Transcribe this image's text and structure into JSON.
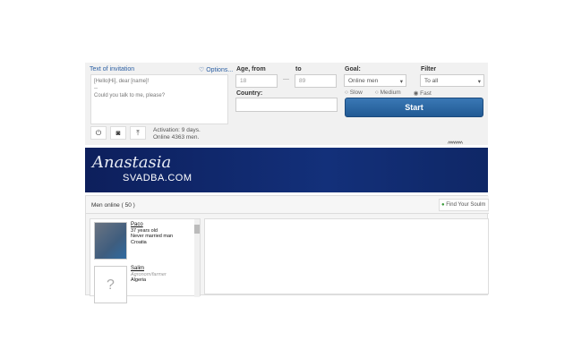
{
  "invitation": {
    "title": "Text of invitation",
    "options": "♡ Options...",
    "line1": "[Hello|Hi], dear [name]!",
    "line2": "--",
    "line3": "Could you talk to me, please?",
    "activation": "Activation: 9 days.",
    "online": "Online 4363 men."
  },
  "age": {
    "label_from": "Age, from",
    "from": "18",
    "dash": "—",
    "label_to": "to",
    "to": "89"
  },
  "country": {
    "label": "Country:",
    "value": ""
  },
  "goal": {
    "label": "Goal:",
    "value": "Online men"
  },
  "filter": {
    "label": "Filter",
    "value": "To all"
  },
  "speed": {
    "options": [
      "Slow",
      "Medium",
      "Fast"
    ],
    "selected": "Fast"
  },
  "start_label": "Start",
  "banner": {
    "logo_script": "Anastasia",
    "logo_domain": "SVADBA.COM",
    "stars": "^^^^^^^"
  },
  "men": {
    "header": "Men online ( 50 )",
    "find_button": "Find Your Soulm",
    "list": [
      {
        "name": "Paco",
        "age": "37 years old",
        "status": "Never married man",
        "country": "Croatia"
      },
      {
        "name": "Salim",
        "age": "",
        "status": "Agronom/farmer",
        "country": "Algeria"
      }
    ]
  }
}
